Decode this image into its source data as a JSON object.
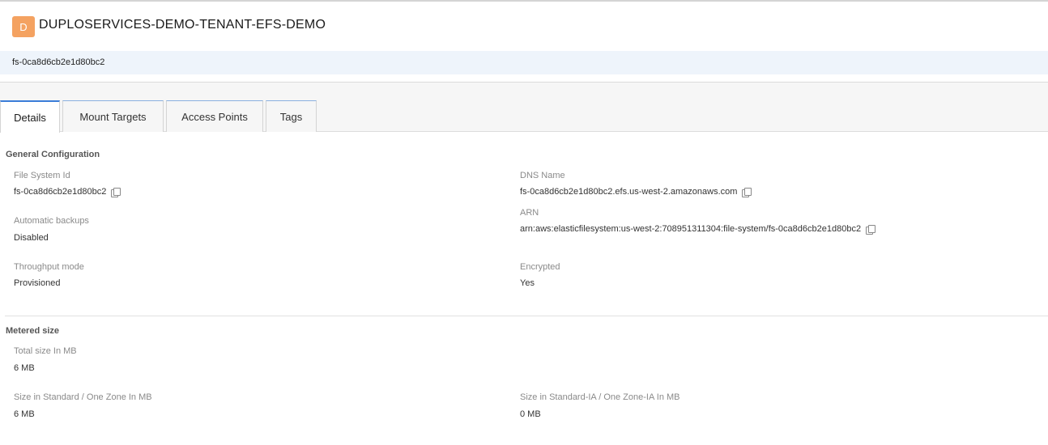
{
  "header": {
    "badge_letter": "D",
    "title": "DUPLOSERVICES-DEMO-TENANT-EFS-DEMO",
    "badge_color": "#f4a261"
  },
  "resource_id": "fs-0ca8d6cb2e1d80bc2",
  "tabs": [
    {
      "label": "Details",
      "active": true
    },
    {
      "label": "Mount Targets",
      "active": false
    },
    {
      "label": "Access Points",
      "active": false
    },
    {
      "label": "Tags",
      "active": false
    }
  ],
  "general": {
    "title": "General Configuration",
    "file_system_id": {
      "label": "File System Id",
      "value": "fs-0ca8d6cb2e1d80bc2"
    },
    "automatic_backups": {
      "label": "Automatic backups",
      "value": "Disabled"
    },
    "throughput_mode": {
      "label": "Throughput mode",
      "value": "Provisioned"
    },
    "dns_name": {
      "label": "DNS Name",
      "value": "fs-0ca8d6cb2e1d80bc2.efs.us-west-2.amazonaws.com"
    },
    "arn": {
      "label": "ARN",
      "value": "arn:aws:elasticfilesystem:us-west-2:708951311304:file-system/fs-0ca8d6cb2e1d80bc2"
    },
    "encrypted": {
      "label": "Encrypted",
      "value": "Yes"
    }
  },
  "metered": {
    "title": "Metered size",
    "total": {
      "label": "Total size In MB",
      "value": "6 MB"
    },
    "standard": {
      "label": "Size in Standard / One Zone In MB",
      "value": "6 MB"
    },
    "standard_ia": {
      "label": "Size in Standard-IA / One Zone-IA In MB",
      "value": "0 MB"
    }
  },
  "colors": {
    "accent": "#3b7dd8",
    "id_bar": "#eef4fb"
  }
}
